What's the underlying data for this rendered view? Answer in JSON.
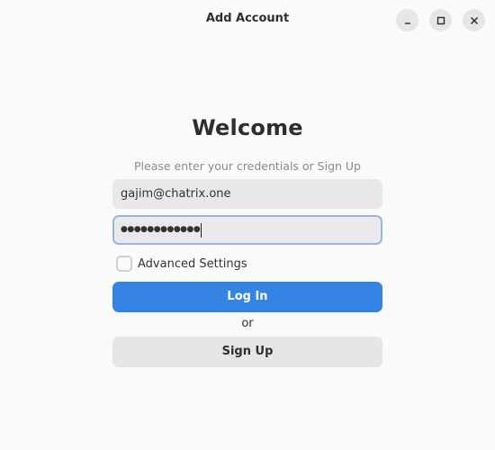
{
  "window": {
    "title": "Add Account",
    "controls": {
      "minimize_icon": "minimize-icon",
      "maximize_icon": "maximize-icon",
      "close_icon": "close-icon"
    }
  },
  "form": {
    "heading": "Welcome",
    "subtitle": "Please enter your credentials or Sign Up",
    "email_value": "gajim@chatrix.one",
    "password_masked": "●●●●●●●●●●●●",
    "advanced_settings_label": "Advanced Settings",
    "advanced_settings_checked": false,
    "login_label": "Log In",
    "or_label": "or",
    "signup_label": "Sign Up"
  },
  "colors": {
    "accent": "#3584e4",
    "window_bg": "#fafafa",
    "field_bg": "#e8e8e8",
    "focus_border": "#98b6d9"
  }
}
